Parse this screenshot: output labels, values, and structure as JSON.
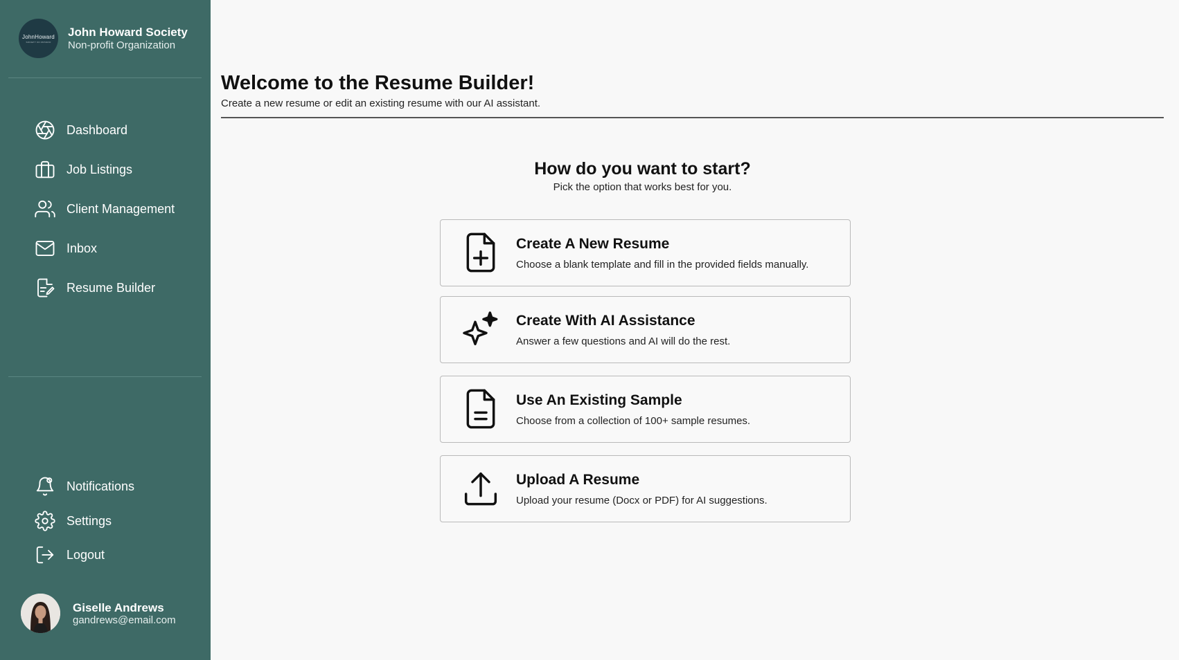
{
  "sidebar": {
    "brand": {
      "logo_text": "JohnHoward",
      "logo_subtext": "SOCIETY OF ONTARIO",
      "name": "John Howard Society",
      "type": "Non-profit Organization"
    },
    "nav": [
      {
        "label": "Dashboard",
        "icon": "aperture-icon"
      },
      {
        "label": "Job Listings",
        "icon": "briefcase-icon"
      },
      {
        "label": "Client Management",
        "icon": "users-icon"
      },
      {
        "label": "Inbox",
        "icon": "mail-icon"
      },
      {
        "label": "Resume Builder",
        "icon": "document-edit-icon"
      }
    ],
    "bottom_nav": [
      {
        "label": "Notifications",
        "icon": "bell-icon"
      },
      {
        "label": "Settings",
        "icon": "gear-icon"
      },
      {
        "label": "Logout",
        "icon": "logout-icon"
      }
    ],
    "user": {
      "name": "Giselle Andrews",
      "email": "gandrews@email.com"
    }
  },
  "main": {
    "title": "Welcome to the Resume Builder!",
    "subtitle": "Create a new resume or edit an existing resume with our AI assistant.",
    "section_title": "How do you want to start?",
    "section_subtitle": "Pick the option that works best for you.",
    "options": [
      {
        "title": "Create A New Resume",
        "description": "Choose a blank template and fill in the provided fields manually.",
        "icon": "file-plus-icon"
      },
      {
        "title": "Create With AI Assistance",
        "description": "Answer a few questions and AI will do the rest.",
        "icon": "sparkles-icon"
      },
      {
        "title": "Use An Existing Sample",
        "description": "Choose from a collection of 100+ sample resumes.",
        "icon": "file-text-icon"
      },
      {
        "title": "Upload A Resume",
        "description": "Upload your resume (Docx or PDF) for AI suggestions.",
        "icon": "upload-icon"
      }
    ]
  },
  "colors": {
    "sidebar_bg": "#3e6a66",
    "page_bg": "#f8f8f8",
    "card_border": "#b9b9b9",
    "text": "#111111"
  }
}
